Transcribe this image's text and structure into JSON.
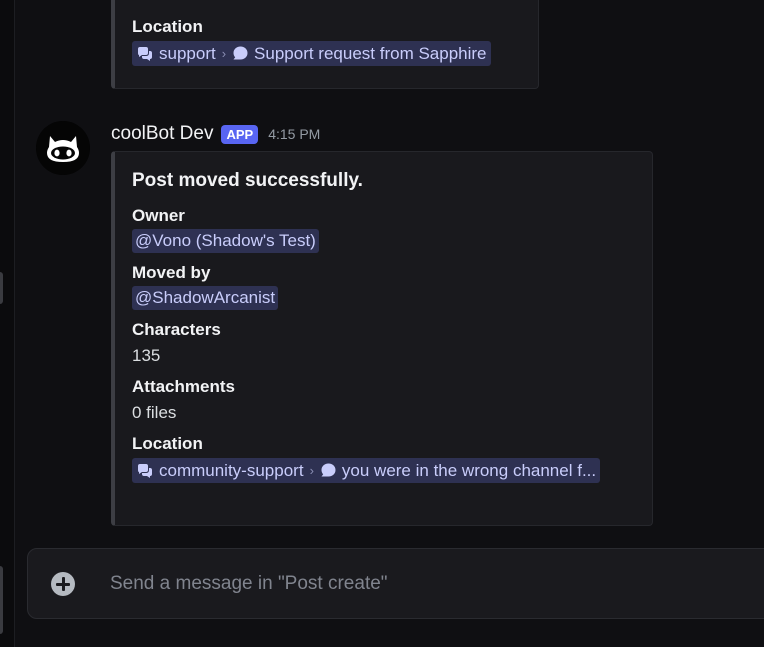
{
  "prev_embed": {
    "location_label": "Location",
    "location_channel": "support",
    "location_thread": "Support request from Sapphire"
  },
  "message": {
    "username": "coolBot Dev",
    "badge": "APP",
    "timestamp": "4:15 PM",
    "embed": {
      "title": "Post moved successfully.",
      "fields": {
        "owner": {
          "name": "Owner",
          "value": "@Vono (Shadow's Test)"
        },
        "moved_by": {
          "name": "Moved by",
          "value": "@ShadowArcanist"
        },
        "characters": {
          "name": "Characters",
          "value": "135"
        },
        "attachments": {
          "name": "Attachments",
          "value": "0 files"
        },
        "location": {
          "name": "Location",
          "channel": "community-support",
          "thread": "you were in the wrong channel f..."
        }
      }
    }
  },
  "composer": {
    "placeholder": "Send a message in \"Post create\""
  },
  "icons": {
    "forum": "forum-channel-icon",
    "thread": "thread-bubble-icon",
    "chevron": "chevron-right-icon",
    "add": "add-circle-icon",
    "avatar": "github-octocat-avatar"
  },
  "colors": {
    "mention_bg": "#2e3152",
    "mention_text": "#c9cdfb",
    "app_badge": "#5865f2",
    "embed_border": "#3d3e44"
  }
}
